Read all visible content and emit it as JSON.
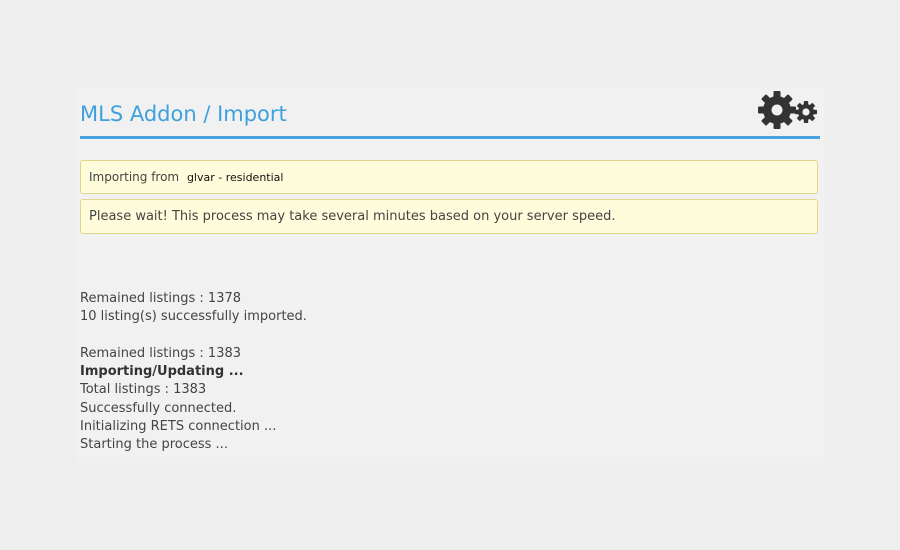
{
  "header": {
    "title": "MLS Addon / Import",
    "icon": "gears-icon"
  },
  "source_notice": {
    "label": "Importing from",
    "value": "glvar - residential"
  },
  "wait_notice": {
    "text": "Please wait! This process may take several minutes based on your server speed."
  },
  "log": {
    "group1": [
      "Remained listings : 1378",
      "10 listing(s) successfully imported."
    ],
    "group2": [
      "Remained listings : 1383",
      "Importing/Updating ...",
      "Total listings : 1383",
      "Successfully connected.",
      "Initializing RETS connection ...",
      "Starting the process ..."
    ]
  },
  "colors": {
    "accent": "#3fa0dd",
    "notice_bg": "#fefcdb",
    "notice_border": "#e3d58c",
    "gear": "#333333"
  }
}
